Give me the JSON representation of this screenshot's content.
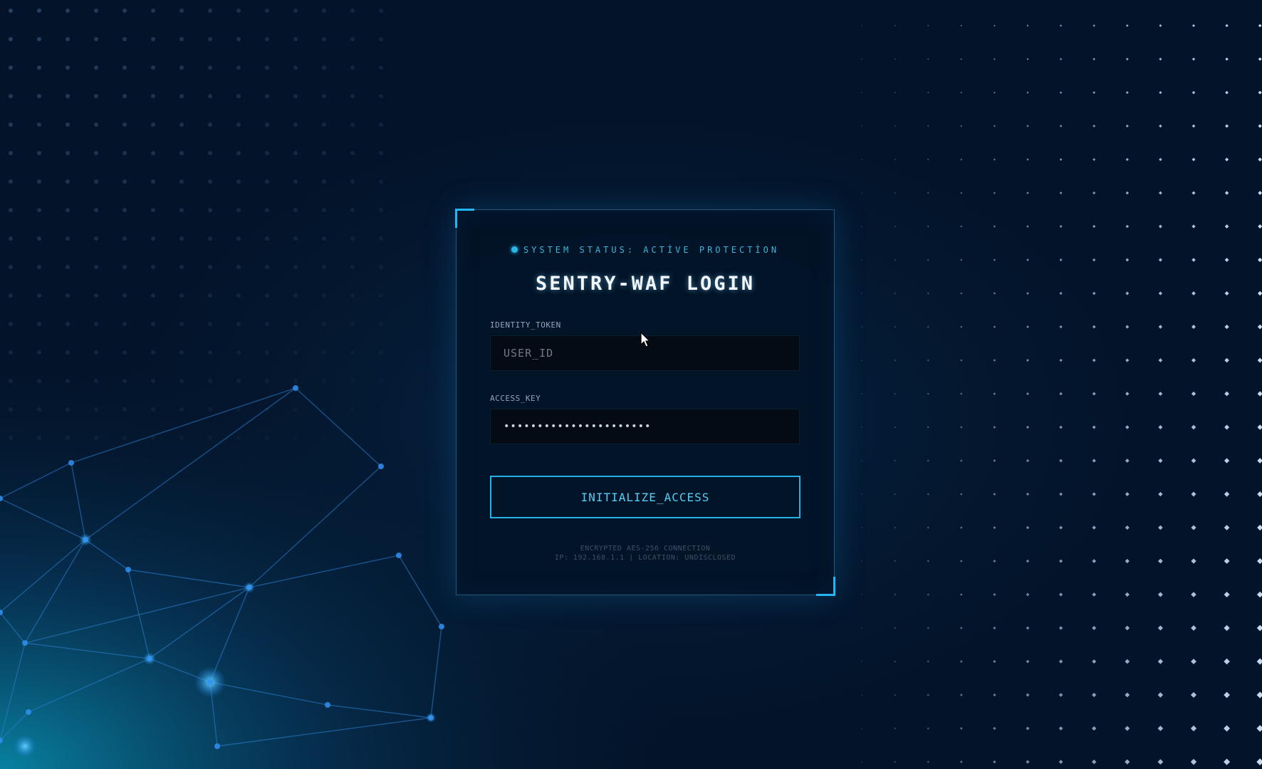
{
  "status": {
    "text": "SYSTEM STATUS: ACTİVE PROTECTİON",
    "indicator_color": "#29b8ea"
  },
  "login": {
    "title": "SENTRY-WAF LOGIN",
    "identity_label": "IDENTITY_TOKEN",
    "identity_placeholder": "USER_ID",
    "identity_value": "",
    "access_label": "ACCESS_KEY",
    "access_value": "••••••••••••••••••••••",
    "submit_label": "INITIALIZE_ACCESS"
  },
  "footer": {
    "line1": "ENCRYPTED AES-256 CONNECTION",
    "line2": "IP: 192.168.1.1 | LOCATION: UNDISCLOSED"
  },
  "theme": {
    "accent": "#27b0e6",
    "background": "#03142a",
    "panel": "#021426"
  }
}
